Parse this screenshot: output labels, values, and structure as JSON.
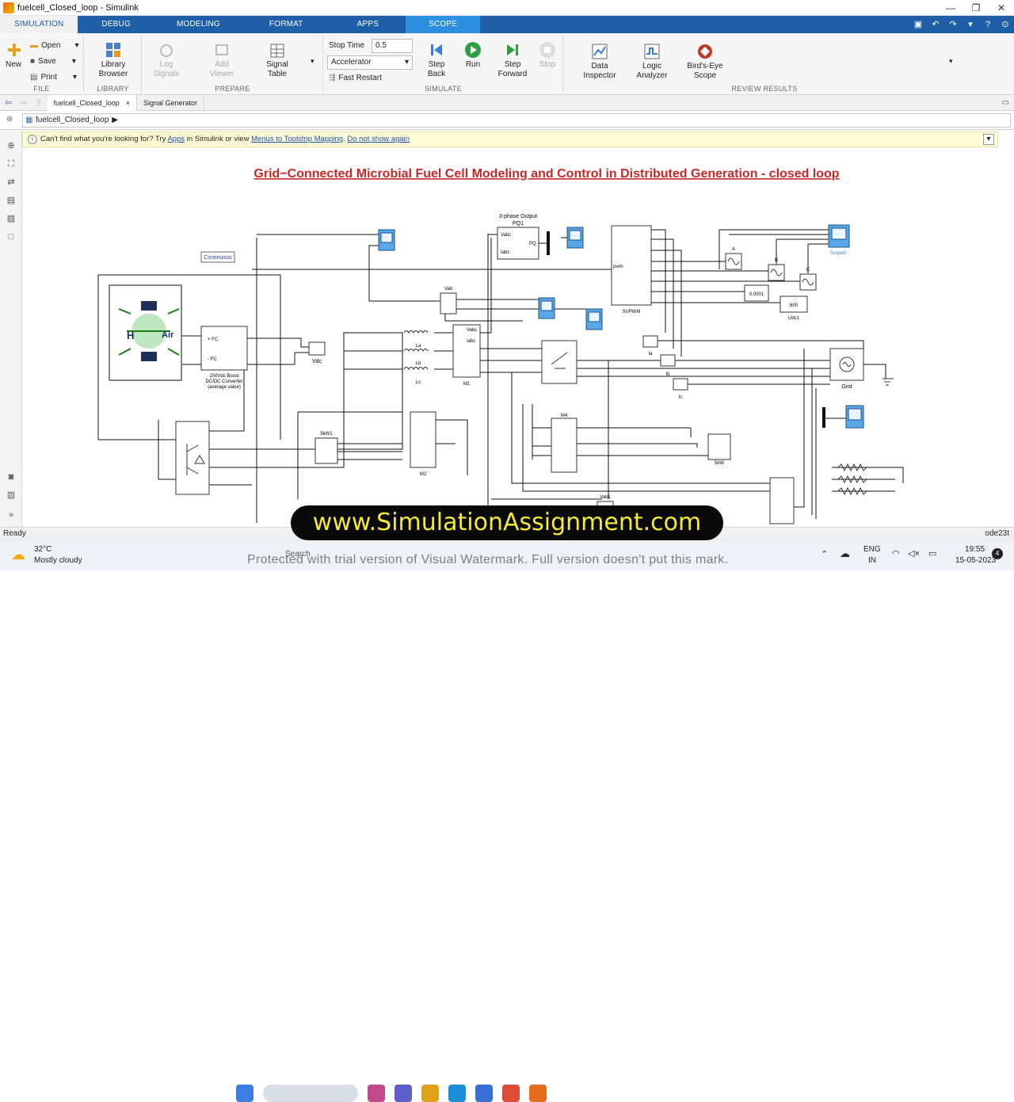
{
  "window": {
    "title": "fuelcell_Closed_loop - Simulink"
  },
  "tabs": [
    "SIMULATION",
    "DEBUG",
    "MODELING",
    "FORMAT",
    "APPS",
    "SCOPE"
  ],
  "ribbon": {
    "file": {
      "new": "New",
      "open": "Open",
      "save": "Save",
      "print": "Print",
      "label": "FILE"
    },
    "library": {
      "browser": "Library Browser",
      "label": "LIBRARY"
    },
    "prepare": {
      "log": "Log Signals",
      "add_viewer": "Add Viewer",
      "signal_table": "Signal Table",
      "label": "PREPARE"
    },
    "simulate": {
      "stop_time_label": "Stop Time",
      "stop_time": "0.5",
      "mode": "Accelerator",
      "fast_restart": "Fast Restart",
      "step_back": "Step Back",
      "run": "Run",
      "step_forward": "Step Forward",
      "stop": "Stop",
      "label": "SIMULATE"
    },
    "review": {
      "data_inspector": "Data Inspector",
      "logic_analyzer": "Logic Analyzer",
      "birds_eye": "Bird's-Eye Scope",
      "label": "REVIEW RESULTS"
    }
  },
  "doc_tabs": [
    "fuelcell_Closed_loop",
    "Signal Generator"
  ],
  "breadcrumb": "fuelcell_Closed_loop",
  "infobar": {
    "prefix": "Can't find what you're looking for? Try ",
    "apps": "Apps",
    "mid": " in Simulink or view ",
    "link1": "Menus to Toolstrip Mapping",
    "dot": ". ",
    "link2": "Do not show again"
  },
  "diagram": {
    "title": "Grid−Connected Microbial Fuel Cell Modeling and Control in Distributed Generation - closed loop",
    "labels": {
      "continuous": "Continuous",
      "pq_top": "3-phase Output",
      "pq": "PQ1",
      "vdc": "Vdc",
      "boost": "100Vdc Boost\nDC/DC Converter\n(average value)",
      "vab": "Vab",
      "la": "La",
      "lb": "Lb",
      "lc": "Lc",
      "m1": "M1",
      "m2": "M2",
      "m4": "M4",
      "svpwm": "SVPWM",
      "scope5": "Scope5",
      "a": "A",
      "b": "B",
      "c": "C",
      "const1": "0.0001",
      "const2": "600",
      "udc1": "Udc1",
      "ia": "Ia",
      "ib": "Ib",
      "ic": "Ic",
      "grid": "Grid",
      "kw1": "5kW1",
      "kw": "5kW",
      "vab1": "Vab1",
      "h2": "H",
      "air": "Air"
    }
  },
  "status": {
    "left": "Ready",
    "right": "ode23t"
  },
  "banner": "www.SimulationAssignment.com",
  "watermark": "Protected with trial version of Visual Watermark. Full version doesn't put this mark.",
  "taskbar": {
    "temp": "32°C",
    "weather": "Mostly cloudy",
    "search": "Search",
    "lang1": "ENG",
    "lang2": "IN",
    "time": "19:55",
    "date": "15-05-2023",
    "badge": "4"
  }
}
